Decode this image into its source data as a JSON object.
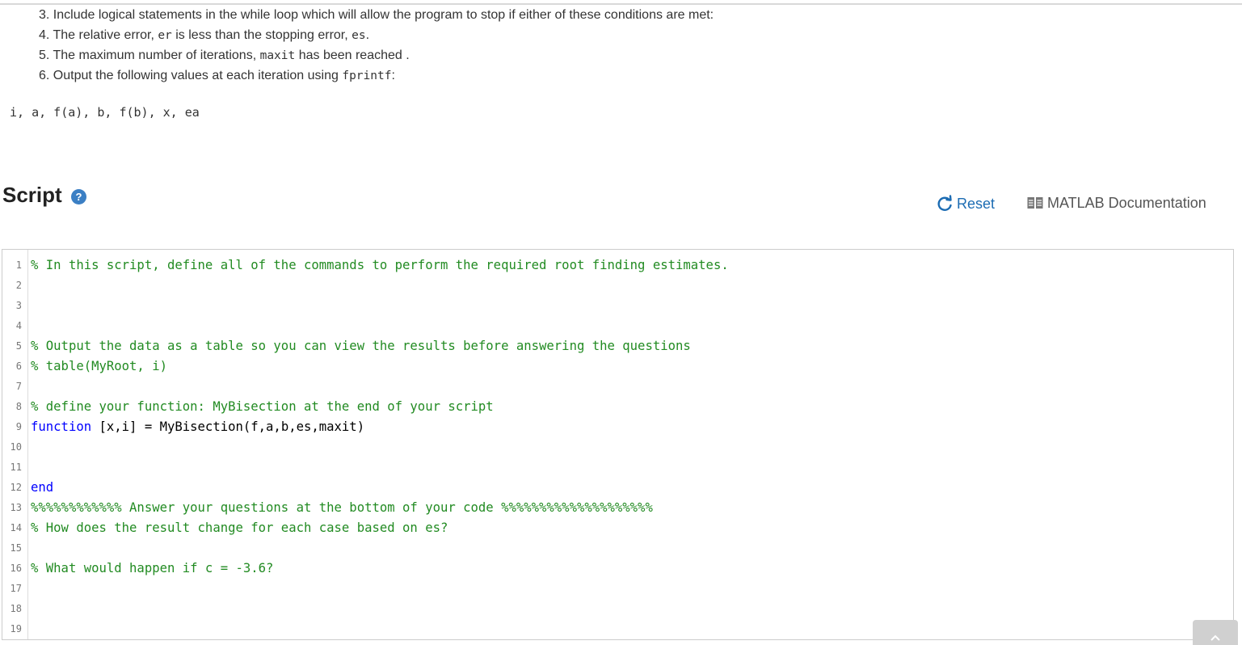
{
  "instructions": [
    {
      "parts": [
        {
          "t": "3. Include logical statements in the while loop which will allow the program to stop if either of these conditions are met:"
        }
      ]
    },
    {
      "parts": [
        {
          "t": "4. The relative error, "
        },
        {
          "t": "er",
          "code": true
        },
        {
          "t": " is less than the stopping error, "
        },
        {
          "t": "es",
          "code": true
        },
        {
          "t": "."
        }
      ]
    },
    {
      "parts": [
        {
          "t": "5. The maximum number of iterations, "
        },
        {
          "t": "maxit",
          "code": true
        },
        {
          "t": " has been reached ."
        }
      ]
    },
    {
      "parts": [
        {
          "t": "6. Output the following values at each iteration using "
        },
        {
          "t": "fprintf",
          "code": true
        },
        {
          "t": ":"
        }
      ]
    }
  ],
  "output_vars": "i, a, f(a), b, f(b), x, ea",
  "script": {
    "title": "Script",
    "help_icon": "question-circle-icon",
    "reset_label": "Reset",
    "reset_icon": "refresh-icon",
    "doc_label": "MATLAB Documentation",
    "doc_icon": "book-icon"
  },
  "editor": {
    "lines": [
      {
        "n": "1",
        "tokens": [
          {
            "t": "% In this script, define all of the commands to perform the required root finding estimates.",
            "c": "comment"
          }
        ]
      },
      {
        "n": "2",
        "tokens": []
      },
      {
        "n": "3",
        "tokens": []
      },
      {
        "n": "4",
        "tokens": []
      },
      {
        "n": "5",
        "tokens": [
          {
            "t": "% Output the data as a table so you can view the results before answering the questions",
            "c": "comment"
          }
        ]
      },
      {
        "n": "6",
        "tokens": [
          {
            "t": "% table(MyRoot, i)",
            "c": "comment"
          }
        ]
      },
      {
        "n": "7",
        "tokens": []
      },
      {
        "n": "8",
        "tokens": [
          {
            "t": "% define your function: MyBisection at the end of your script",
            "c": "comment"
          }
        ]
      },
      {
        "n": "9",
        "tokens": [
          {
            "t": "function",
            "c": "keyword"
          },
          {
            "t": " [x,i] = MyBisection(f,a,b,es,maxit)",
            "c": "plain"
          }
        ]
      },
      {
        "n": "10",
        "tokens": []
      },
      {
        "n": "11",
        "tokens": []
      },
      {
        "n": "12",
        "tokens": [
          {
            "t": "end",
            "c": "keyword"
          }
        ]
      },
      {
        "n": "13",
        "tokens": [
          {
            "t": "%%%%%%%%%%%% Answer your questions at the bottom of your code %%%%%%%%%%%%%%%%%%%%",
            "c": "comment"
          }
        ]
      },
      {
        "n": "14",
        "tokens": [
          {
            "t": "% How does the result change for each case based on es?",
            "c": "comment"
          }
        ]
      },
      {
        "n": "15",
        "tokens": []
      },
      {
        "n": "16",
        "tokens": [
          {
            "t": "% What would happen if c = -3.6?",
            "c": "comment"
          }
        ]
      },
      {
        "n": "17",
        "tokens": []
      },
      {
        "n": "18",
        "tokens": []
      },
      {
        "n": "19",
        "tokens": []
      }
    ]
  },
  "scroll_top_icon": "chevron-up-icon",
  "colors": {
    "comment": "#228b22",
    "keyword": "#0000ff",
    "link": "#1c6cb3",
    "help": "#3b7fc4"
  }
}
